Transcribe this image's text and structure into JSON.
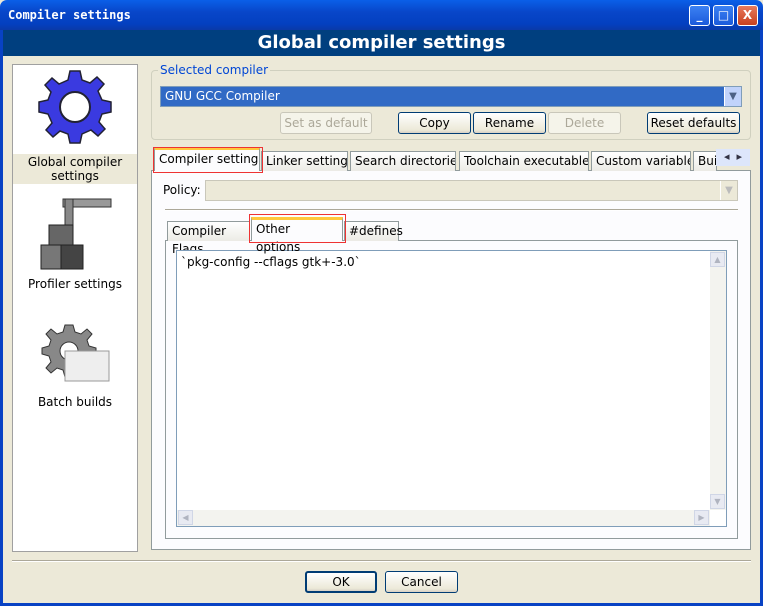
{
  "window": {
    "title": "Compiler settings",
    "minimize": "_",
    "maximize": "□",
    "close": "X"
  },
  "header": {
    "title": "Global compiler settings"
  },
  "sidebar": {
    "items": [
      {
        "label": "Global compiler settings",
        "icon": "gear-icon",
        "selected": true
      },
      {
        "label": "Profiler settings",
        "icon": "profiler-icon"
      },
      {
        "label": "Batch builds",
        "icon": "batch-builds-icon"
      }
    ]
  },
  "compiler_group": {
    "label": "Selected compiler",
    "selected": "GNU GCC Compiler",
    "buttons": {
      "set_default": "Set as default",
      "copy": "Copy",
      "rename": "Rename",
      "delete": "Delete",
      "reset": "Reset defaults"
    }
  },
  "tabs": [
    {
      "label": "Compiler settings",
      "active": true
    },
    {
      "label": "Linker settings"
    },
    {
      "label": "Search directories"
    },
    {
      "label": "Toolchain executables"
    },
    {
      "label": "Custom variables"
    },
    {
      "label": "Build options"
    }
  ],
  "tab_scroll": {
    "left": "◂",
    "right": "▸"
  },
  "policy": {
    "label": "Policy:",
    "value": ""
  },
  "inner_tabs": [
    {
      "label": "Compiler Flags"
    },
    {
      "label": "Other options",
      "active": true
    },
    {
      "label": "#defines"
    }
  ],
  "other_options": {
    "text": "`pkg-config --cflags gtk+-3.0`"
  },
  "footer": {
    "ok": "OK",
    "cancel": "Cancel"
  },
  "colors": {
    "header_bg": "#003f7f",
    "selection": "#316ac5",
    "highlight_box": "#ee3333"
  }
}
